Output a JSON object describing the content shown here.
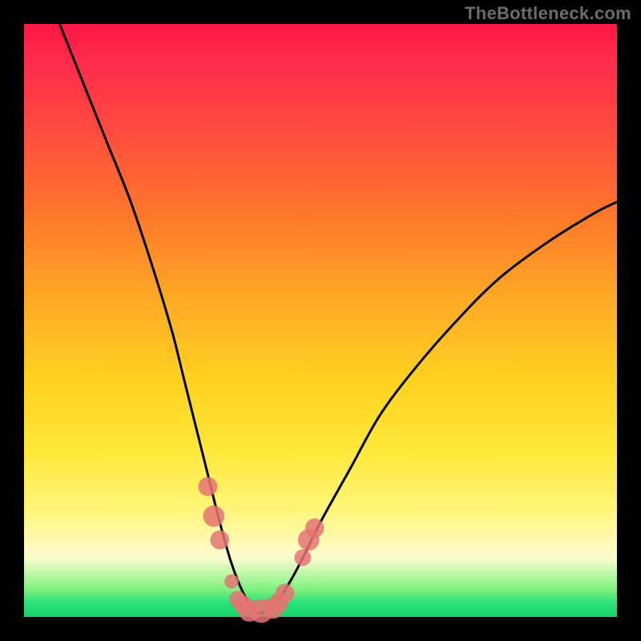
{
  "watermark": "TheBottleneck.com",
  "colors": {
    "frame": "#000000",
    "gradient_top": "#ff1744",
    "gradient_mid": "#ffd11f",
    "gradient_bottom": "#17d06a",
    "curve": "#000000",
    "marker": "#e57373"
  },
  "chart_data": {
    "type": "line",
    "title": "",
    "xlabel": "",
    "ylabel": "",
    "xlim": [
      0,
      100
    ],
    "ylim": [
      0,
      100
    ],
    "grid": false,
    "legend": false,
    "series": [
      {
        "name": "bottleneck-curve",
        "x": [
          6,
          10,
          14,
          18,
          22,
          25,
          27,
          29,
          31,
          33,
          35,
          37,
          39,
          41,
          43,
          46,
          50,
          55,
          60,
          66,
          73,
          80,
          88,
          96,
          100
        ],
        "values": [
          100,
          90,
          80,
          70,
          58,
          48,
          40,
          32,
          24,
          16,
          9,
          4,
          1,
          1,
          3,
          8,
          16,
          25,
          34,
          42,
          50,
          57,
          63,
          68,
          70
        ]
      }
    ],
    "markers": [
      {
        "x": 31,
        "y": 22,
        "r": 1.6
      },
      {
        "x": 32,
        "y": 17,
        "r": 1.8
      },
      {
        "x": 33,
        "y": 13,
        "r": 1.6
      },
      {
        "x": 35,
        "y": 6,
        "r": 1.2
      },
      {
        "x": 36,
        "y": 3,
        "r": 1.4
      },
      {
        "x": 37,
        "y": 2,
        "r": 1.6
      },
      {
        "x": 38,
        "y": 1,
        "r": 1.8
      },
      {
        "x": 40,
        "y": 1,
        "r": 2.0
      },
      {
        "x": 42,
        "y": 1.5,
        "r": 1.8
      },
      {
        "x": 43,
        "y": 2.5,
        "r": 1.6
      },
      {
        "x": 44,
        "y": 4,
        "r": 1.6
      },
      {
        "x": 47,
        "y": 10,
        "r": 1.4
      },
      {
        "x": 48,
        "y": 13,
        "r": 1.8
      },
      {
        "x": 49,
        "y": 15,
        "r": 1.6
      }
    ],
    "annotations": []
  }
}
